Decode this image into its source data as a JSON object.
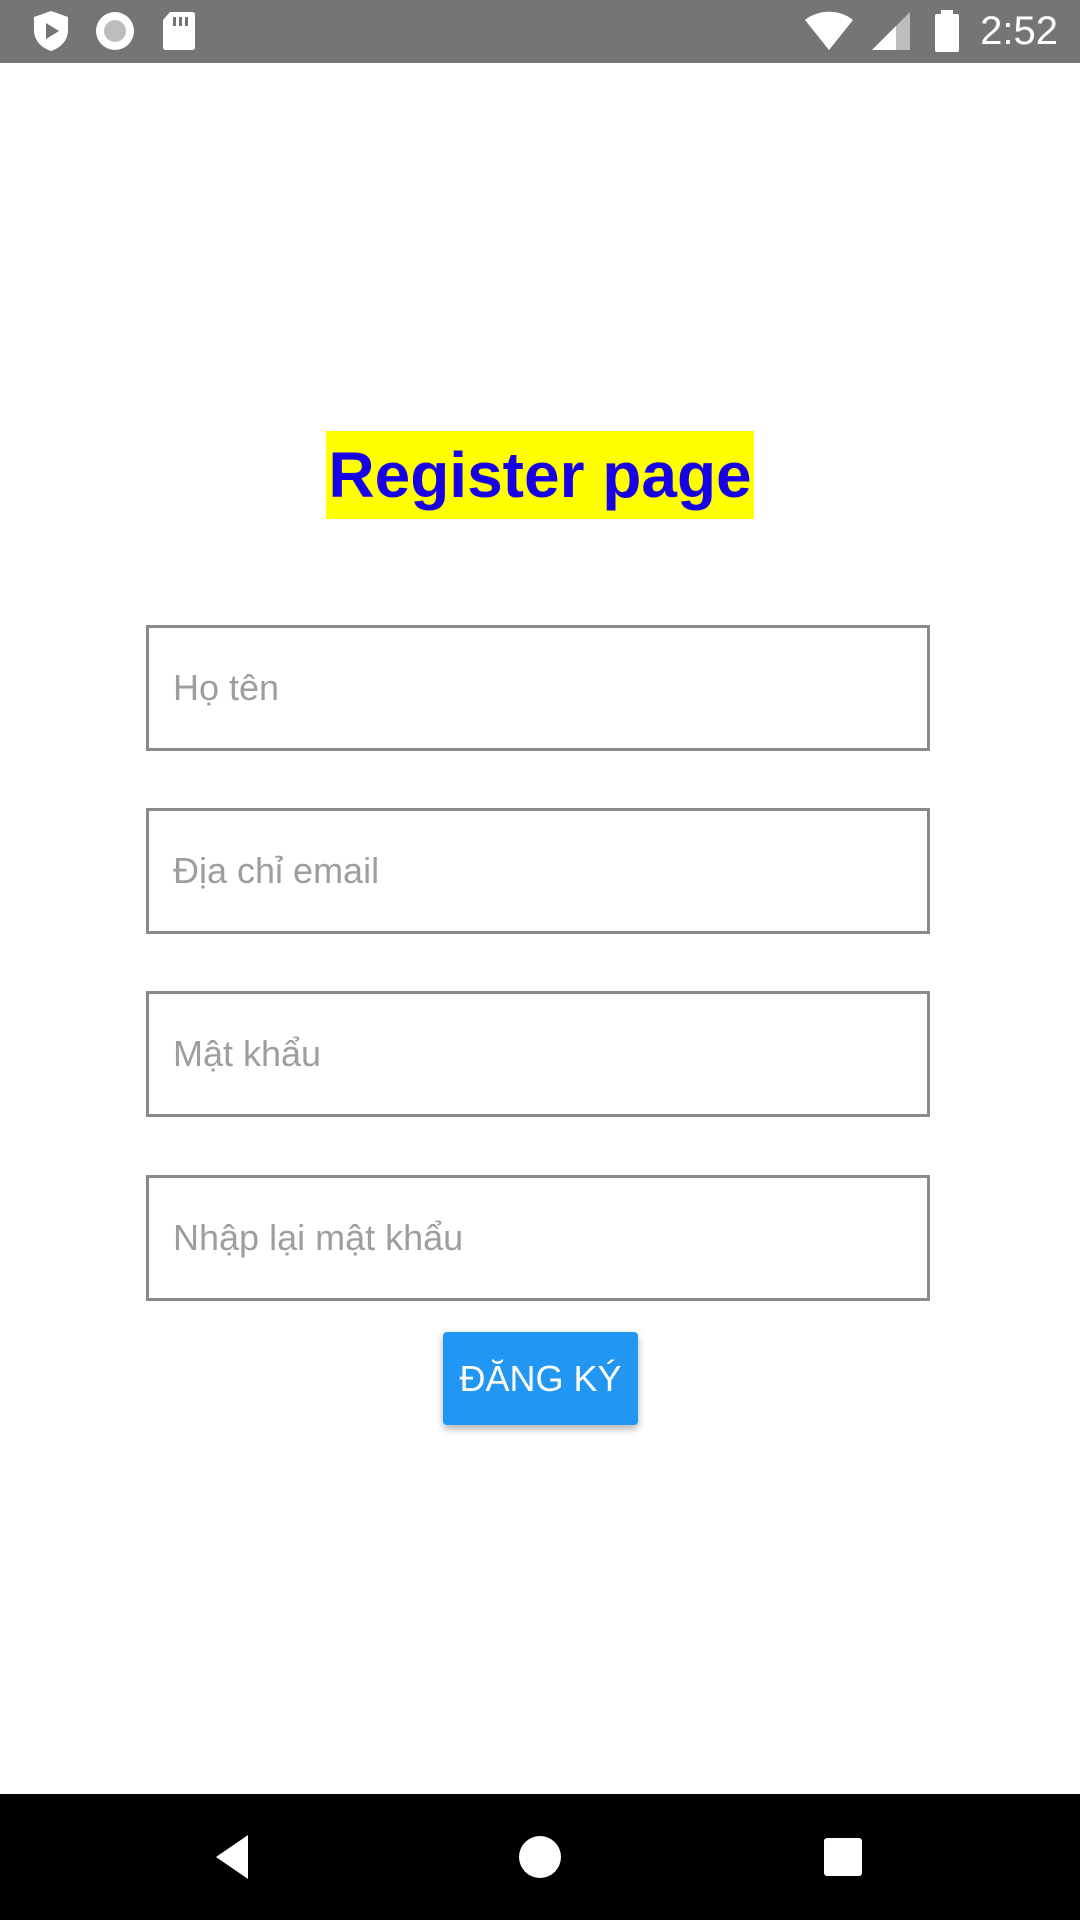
{
  "status_bar": {
    "time": "2:52",
    "left_icons": [
      "shield-play-icon",
      "record-icon",
      "sd-card-icon"
    ],
    "right_icons": [
      "wifi-icon",
      "signal-icon",
      "battery-icon"
    ]
  },
  "page": {
    "title": "Register page"
  },
  "form": {
    "full_name_placeholder": "Họ tên",
    "email_placeholder": "Địa chỉ email",
    "password_placeholder": "Mật khẩu",
    "confirm_password_placeholder": "Nhập lại mật khẩu",
    "submit_label": "ĐĂNG KÝ"
  },
  "nav_bar": {
    "icons": [
      "back-icon",
      "home-icon",
      "recents-icon"
    ]
  },
  "colors": {
    "status_bar": "#757575",
    "title_text": "#1800e6",
    "title_highlight": "#ffff00",
    "button": "#2196f3",
    "nav_bar": "#000000"
  }
}
